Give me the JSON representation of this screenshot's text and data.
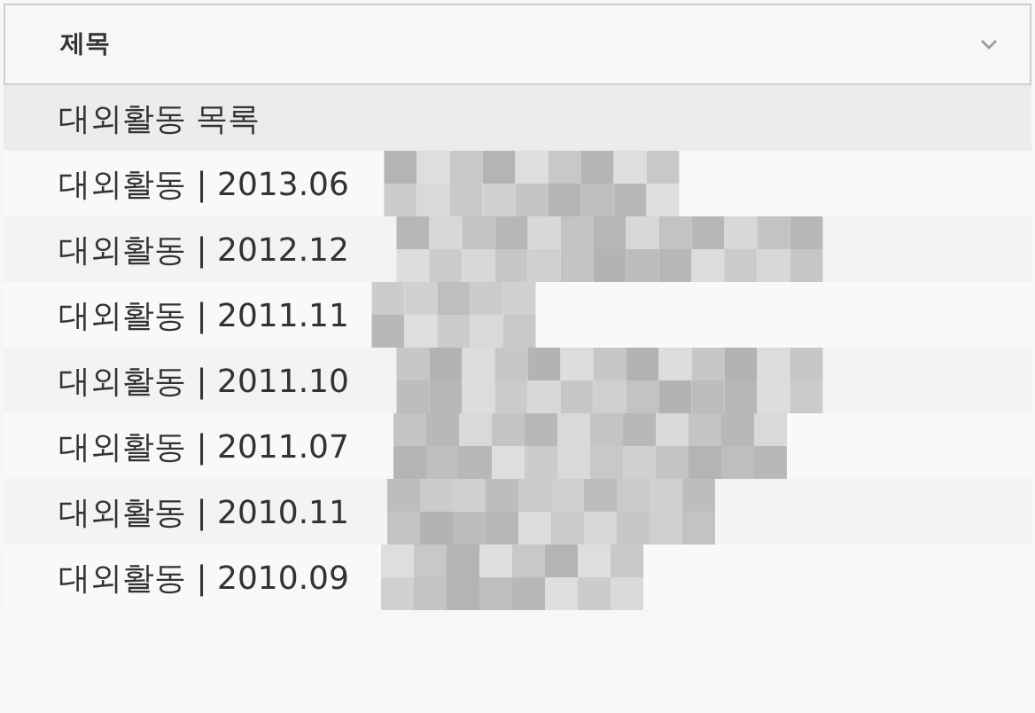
{
  "dropdown": {
    "label": "제목",
    "expanded": true
  },
  "items": [
    {
      "text": "대외활동 목록",
      "selected": true
    },
    {
      "text": "대외활동 | 2013.06",
      "selected": false
    },
    {
      "text": "대외활동 | 2012.12",
      "selected": false
    },
    {
      "text": "대외활동 | 2011.11",
      "selected": false
    },
    {
      "text": "대외활동 | 2011.10",
      "selected": false
    },
    {
      "text": "대외활동 | 2011.07",
      "selected": false
    },
    {
      "text": "대외활동 | 2010.11",
      "selected": false
    },
    {
      "text": "대외활동 | 2010.09",
      "selected": false
    }
  ]
}
